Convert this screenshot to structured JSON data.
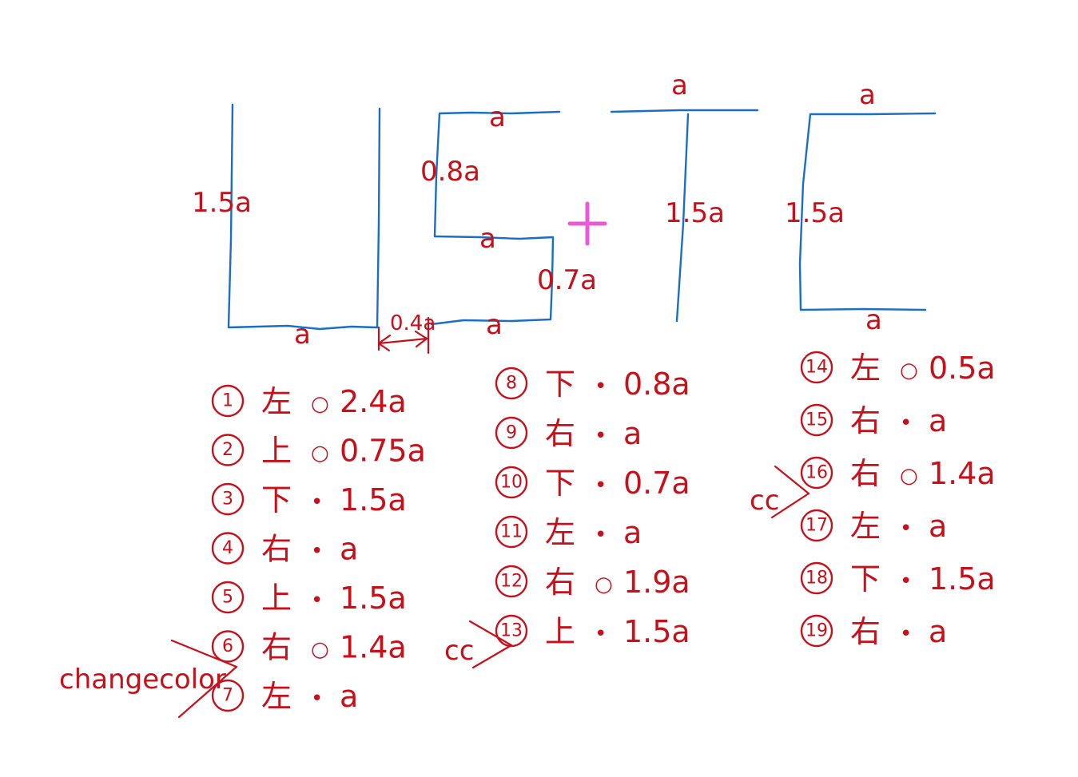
{
  "colors": {
    "stroke_ink": "#1a6fc4",
    "annotation_ink": "#c8101a",
    "cursor": "#e85ad6",
    "background": "#ffffff"
  },
  "dimension_labels": {
    "L_height": "1.5a",
    "L_base": "a",
    "gap": "0.4a",
    "S_top": "a",
    "S_upper": "0.8a",
    "S_middle": "a",
    "S_lower": "0.7a",
    "S_bottom": "a",
    "T_top": "a",
    "T_height": "1.5a",
    "C_top": "a",
    "C_height": "1.5a",
    "C_bottom": "a"
  },
  "steps": [
    {
      "num": "1",
      "dir": "左",
      "pen": "○",
      "dist": "2.4a"
    },
    {
      "num": "2",
      "dir": "上",
      "pen": "○",
      "dist": "0.75a"
    },
    {
      "num": "3",
      "dir": "下",
      "pen": "•",
      "dist": "1.5a"
    },
    {
      "num": "4",
      "dir": "右",
      "pen": "•",
      "dist": "a"
    },
    {
      "num": "5",
      "dir": "上",
      "pen": "•",
      "dist": "1.5a"
    },
    {
      "num": "6",
      "dir": "右",
      "pen": "○",
      "dist": "1.4a"
    },
    {
      "num": "7",
      "dir": "左",
      "pen": "•",
      "dist": "a"
    },
    {
      "num": "8",
      "dir": "下",
      "pen": "•",
      "dist": "0.8a"
    },
    {
      "num": "9",
      "dir": "右",
      "pen": "•",
      "dist": "a"
    },
    {
      "num": "10",
      "dir": "下",
      "pen": "•",
      "dist": "0.7a"
    },
    {
      "num": "11",
      "dir": "左",
      "pen": "•",
      "dist": "a"
    },
    {
      "num": "12",
      "dir": "右",
      "pen": "○",
      "dist": "1.9a"
    },
    {
      "num": "13",
      "dir": "上",
      "pen": "•",
      "dist": "1.5a"
    },
    {
      "num": "14",
      "dir": "左",
      "pen": "○",
      "dist": "0.5a"
    },
    {
      "num": "15",
      "dir": "右",
      "pen": "•",
      "dist": "a"
    },
    {
      "num": "16",
      "dir": "右",
      "pen": "○",
      "dist": "1.4a"
    },
    {
      "num": "17",
      "dir": "左",
      "pen": "•",
      "dist": "a"
    },
    {
      "num": "18",
      "dir": "下",
      "pen": "•",
      "dist": "1.5a"
    },
    {
      "num": "19",
      "dir": "右",
      "pen": "•",
      "dist": "a"
    }
  ],
  "notes": {
    "change_color": "changecolor",
    "cc_1": "cc",
    "cc_2": "cc"
  }
}
